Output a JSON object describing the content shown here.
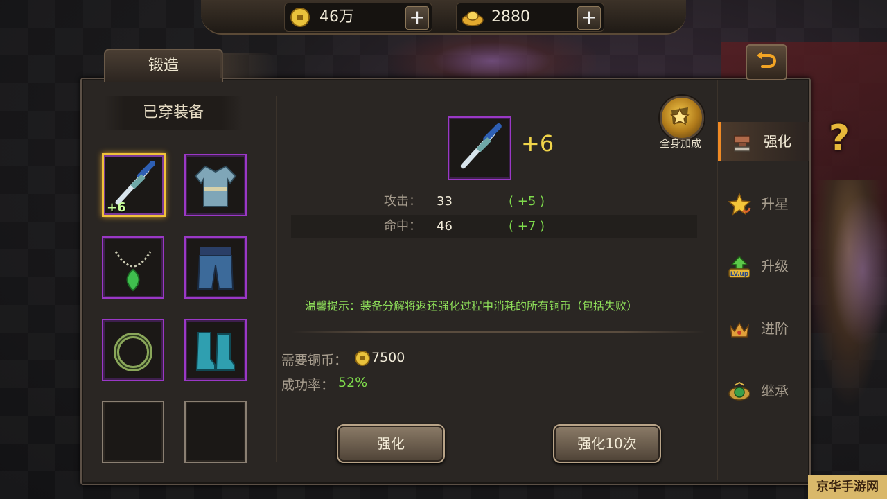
{
  "currencies": [
    {
      "value": "46万",
      "icon": "copper-coin-icon"
    },
    {
      "value": "2880",
      "icon": "gold-ingot-icon"
    }
  ],
  "forge_tab": "锻造",
  "worn_header": "已穿装备",
  "equipment_slots": [
    {
      "item": "sword",
      "level": "+6"
    },
    {
      "item": "robe",
      "level": ""
    },
    {
      "item": "necklace",
      "level": ""
    },
    {
      "item": "pants",
      "level": ""
    },
    {
      "item": "ring",
      "level": ""
    },
    {
      "item": "boots",
      "level": ""
    }
  ],
  "detail": {
    "level": "+6",
    "whole_body_label": "全身加成",
    "stats": [
      {
        "label": "攻击：",
        "value": "33",
        "bonus": "( +5 )"
      },
      {
        "label": "命中：",
        "value": "46",
        "bonus": "( +7 )"
      }
    ],
    "tip": "温馨提示：装备分解将返还强化过程中消耗的所有铜币（包括失败）",
    "cost_label": "需要铜币：",
    "cost_value": "7500",
    "rate_label": "成功率：",
    "rate_value": "52%"
  },
  "buttons": {
    "enhance": "强化",
    "enhance10": "强化10次"
  },
  "side_tabs": [
    {
      "label": "强化",
      "icon": "anvil-icon",
      "active": true
    },
    {
      "label": "升星",
      "icon": "star-icon",
      "active": false
    },
    {
      "label": "升级",
      "icon": "lv-up-icon",
      "active": false
    },
    {
      "label": "进阶",
      "icon": "crown-icon",
      "active": false
    },
    {
      "label": "继承",
      "icon": "emblem-icon",
      "active": false
    }
  ],
  "watermark": "京华手游网",
  "colors": {
    "accent": "#f0c23a",
    "bonus_green": "#7fdc4c",
    "rarity_purple": "#9a38c6",
    "active_tab": "#f08a24"
  }
}
